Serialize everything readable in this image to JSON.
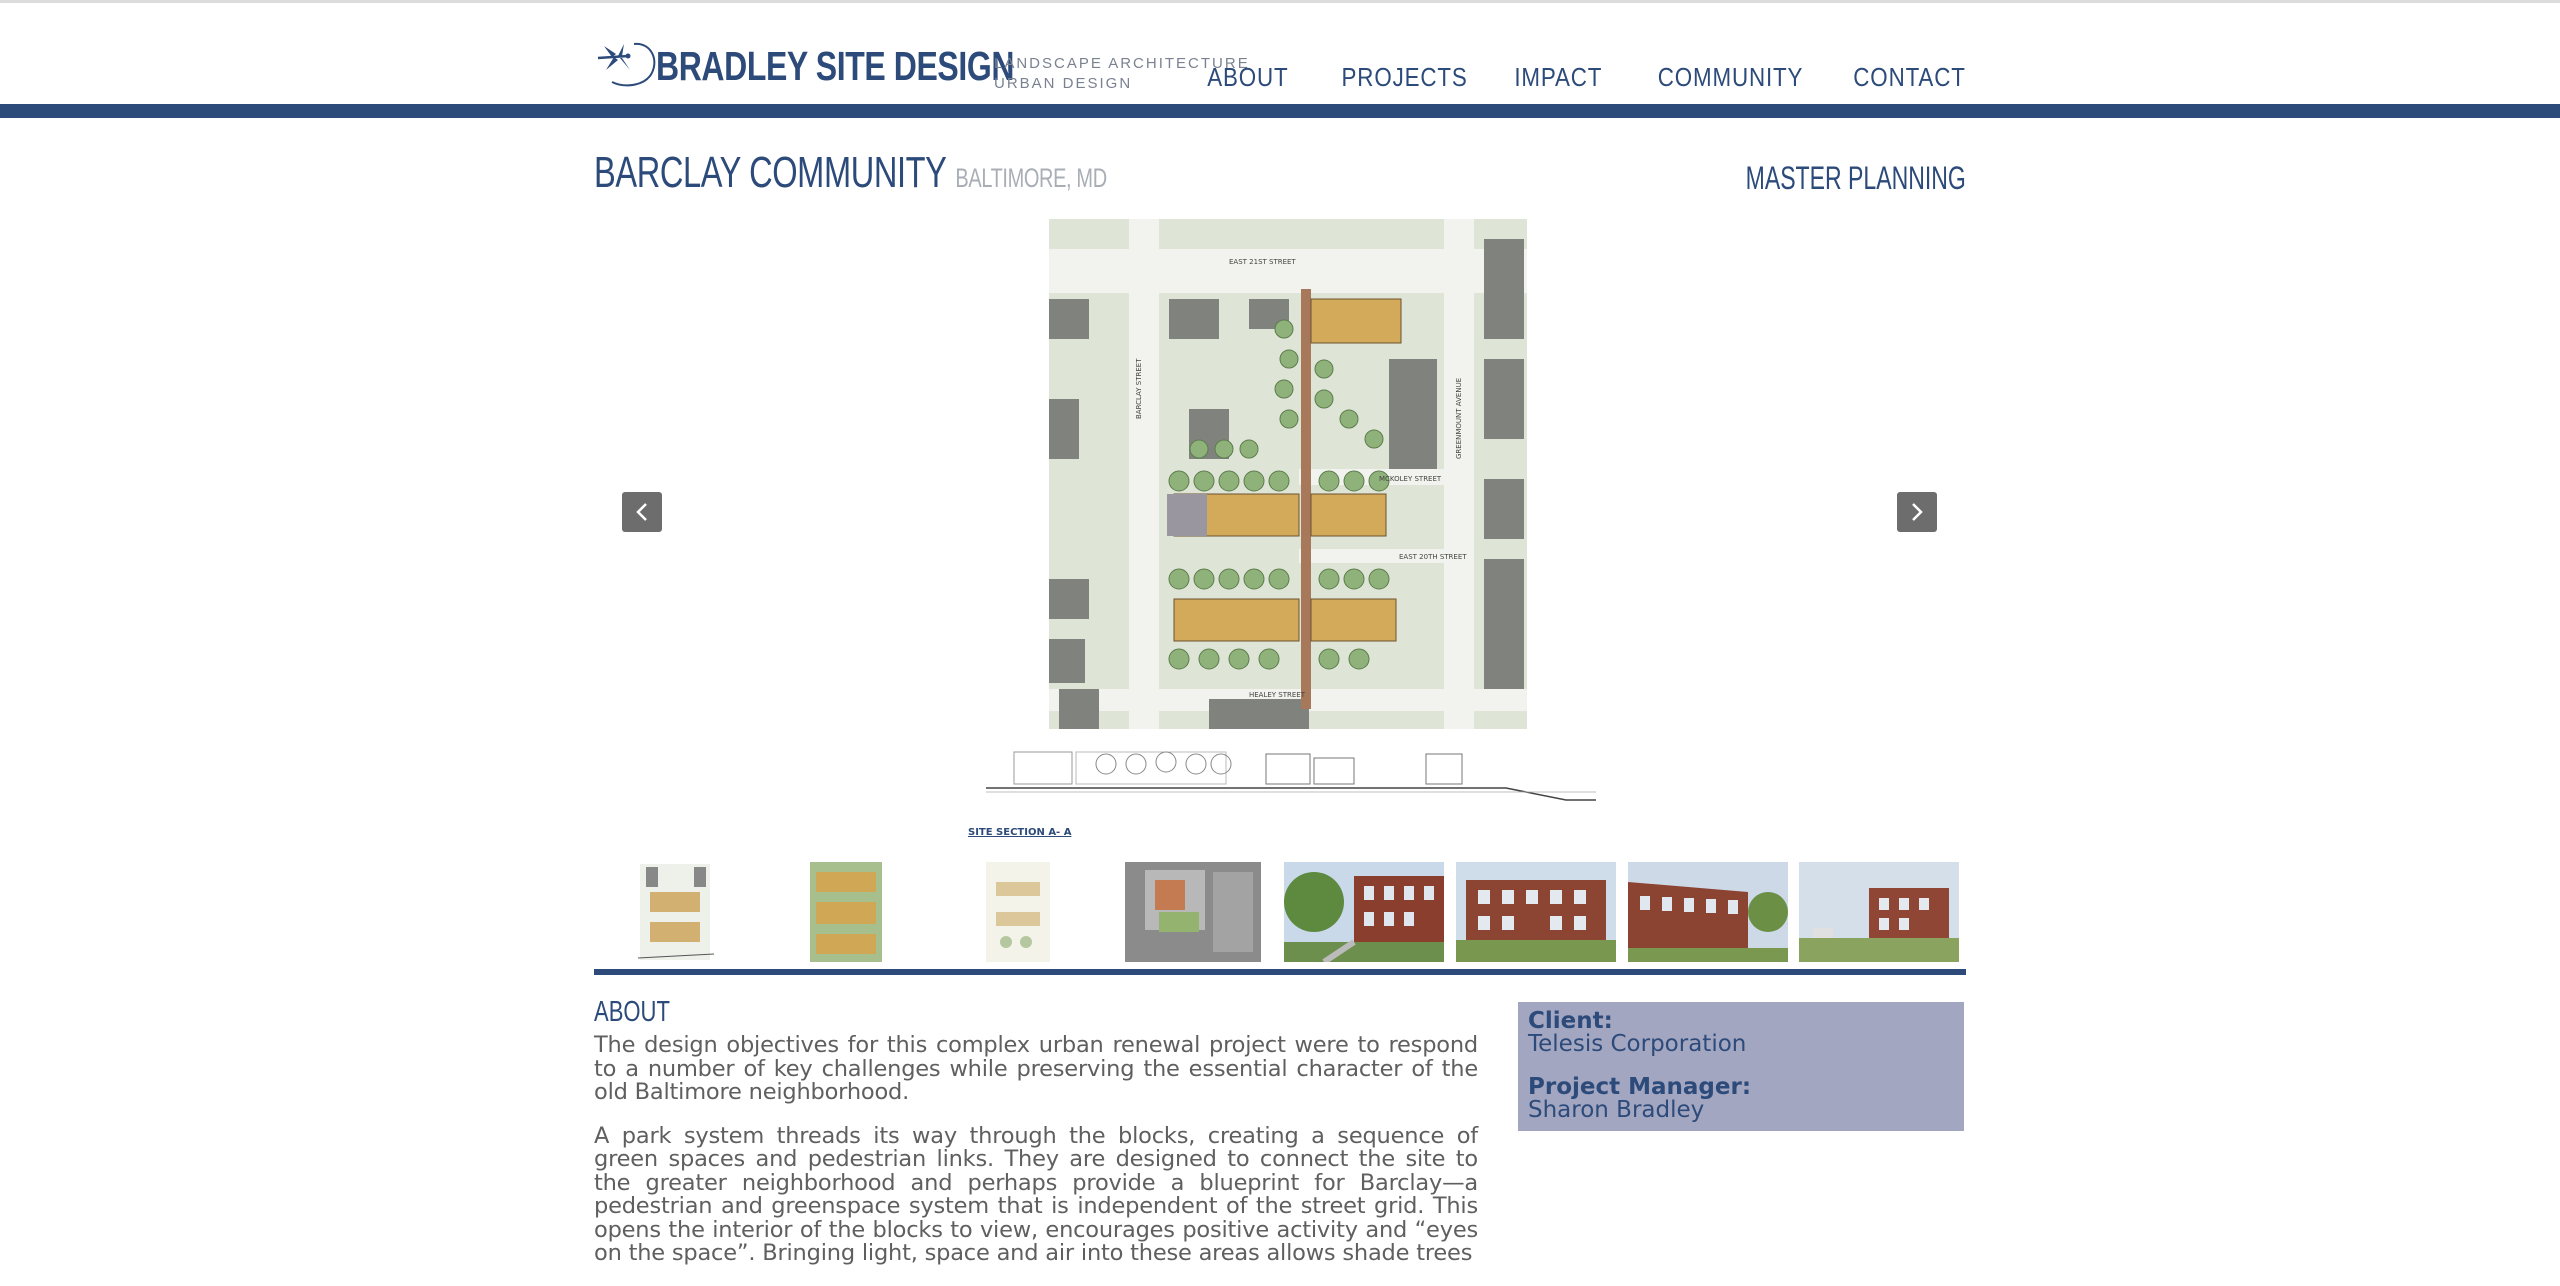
{
  "header": {
    "logo_name": "BRADLEY SITE DESIGN",
    "logo_tagline_1": "LANDSCAPE ARCHITECTURE",
    "logo_tagline_2": "URBAN DESIGN",
    "nav": [
      "ABOUT",
      "PROJECTS",
      "IMPACT",
      "COMMUNITY",
      "CONTACT"
    ]
  },
  "project": {
    "title": "BARCLAY COMMUNITY",
    "location": "BALTIMORE, MD",
    "category": "MASTER PLANNING"
  },
  "gallery": {
    "plan_labels": {
      "top_street": "EAST 21ST STREET",
      "left_street": "BARCLAY STREET",
      "right_street": "GREENMOUNT AVENUE",
      "mid_street": "MCKOLEY STREET",
      "east_street": "EAST 20TH STREET",
      "bottom_street": "HEALEY STREET"
    },
    "section_label": "SITE SECTION A- A",
    "thumbnail_count": 8
  },
  "about": {
    "heading": "ABOUT",
    "paragraphs": [
      "The design objectives for this complex urban renewal project were to respond to a number of key challenges while preserving the essential character of the old Baltimore neighborhood.",
      "A park system threads its way through the blocks, creating a sequence of green spaces and pedestrian links. They are designed to connect the site to the greater neighborhood and perhaps provide a blueprint for Barclay—a pedestrian and greenspace system that is independent of the street grid. This opens the interior of the blocks to view, encourages positive activity and “eyes on the space”. Bringing light, space and air into these areas allows shade trees"
    ]
  },
  "info": {
    "client_label": "Client:",
    "client": "Telesis Corporation",
    "pm_label": "Project Manager:",
    "pm": "Sharon Bradley"
  },
  "colors": {
    "brand": "#2c4a7a",
    "info_bg": "#a3a6c0",
    "muted": "#a9aeb6"
  }
}
